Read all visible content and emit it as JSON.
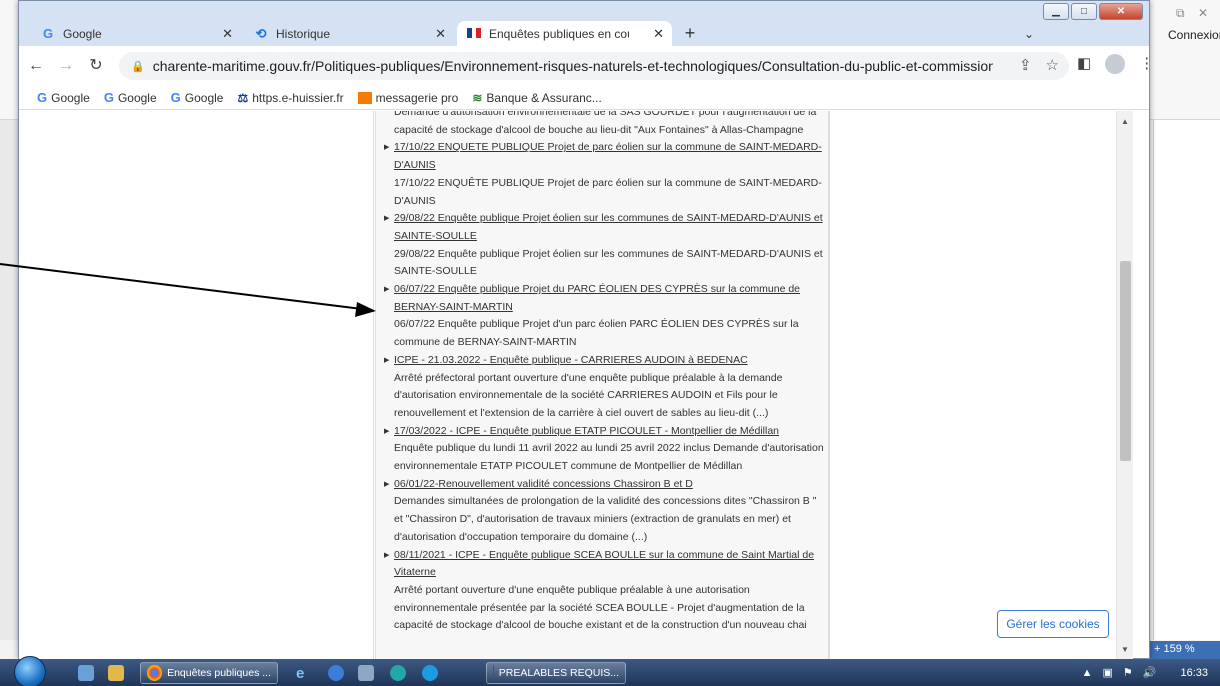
{
  "background_app": {
    "connexion_label": "Connexion",
    "zoom_label": "159 %",
    "window_controls": [
      "restore-icon",
      "close-icon"
    ]
  },
  "browser": {
    "tabs": [
      {
        "title": "Google",
        "icon": "google-icon",
        "active": false
      },
      {
        "title": "Historique",
        "icon": "history-icon",
        "active": false
      },
      {
        "title": "Enquêtes publiques en cours / C",
        "icon": "flag-icon",
        "active": true
      }
    ],
    "new_tab_label": "+",
    "tab_search_label": "⌄",
    "url": "charente-maritime.gouv.fr/Politiques-publiques/Environnement-risques-naturels-et-technologiques/Consultation-du-public-et-commissions-consultati...",
    "bookmarks": [
      {
        "label": "Google",
        "icon": "google-icon"
      },
      {
        "label": "Google",
        "icon": "google-icon"
      },
      {
        "label": "Google",
        "icon": "google-icon"
      },
      {
        "label": "https.e-huissier.fr",
        "icon": "huissier-icon"
      },
      {
        "label": "messagerie pro",
        "icon": "orange-icon"
      },
      {
        "label": "Banque & Assuranc...",
        "icon": "bank-icon"
      }
    ]
  },
  "page": {
    "entries": [
      {
        "link": "",
        "desc": "Demande d'autorisation environnementale de la SAS GOURDET pour l'augmentation de la capacité de stockage d'alcool de bouche au lieu-dit \"Aux Fontaines\" à Allas-Champagne"
      },
      {
        "link": "17/10/22 ENQUETE PUBLIQUE Projet de parc éolien sur la commune de SAINT-MEDARD-D'AUNIS",
        "desc": "17/10/22 ENQUÊTE PUBLIQUE Projet de parc éolien sur la commune de SAINT-MEDARD-D'AUNIS"
      },
      {
        "link": "29/08/22 Enquête publique Projet éolien sur les communes de SAINT-MEDARD-D'AUNIS et SAINTE-SOULLE",
        "desc": "29/08/22 Enquête publique Projet éolien sur les communes de SAINT-MEDARD-D'AUNIS et SAINTE-SOULLE"
      },
      {
        "link": "06/07/22 Enquête publique Projet du PARC ÉOLIEN DES CYPRÈS sur la commune de BERNAY-SAINT-MARTIN",
        "desc": "06/07/22 Enquête publique Projet d'un parc éolien PARC ÉOLIEN DES CYPRÈS sur la commune de BERNAY-SAINT-MARTIN"
      },
      {
        "link": "ICPE - 21.03.2022 - Enquête publique - CARRIERES AUDOIN à BEDENAC",
        "desc": "Arrêté préfectoral portant ouverture d'une enquête publique préalable à la demande d'autorisation environnementale de la société CARRIERES AUDOIN et Fils pour le renouvellement et l'extension de la carrière à ciel ouvert de sables au lieu-dit (...)"
      },
      {
        "link": "17/03/2022 - ICPE - Enquête publique ETATP PICOULET - Montpellier de Médillan",
        "desc": "Enquête publique du lundi 11 avril 2022 au lundi 25 avril 2022 inclus Demande d'autorisation environnementale ETATP PICOULET commune de Montpellier de Médillan"
      },
      {
        "link": "06/01/22-Renouvellement validité concessions Chassiron B et D",
        "desc": "Demandes simultanées de prolongation de la validité des concessions dites \"Chassiron B \" et \"Chassiron D\", d'autorisation de travaux miniers (extraction de granulats en mer) et d'autorisation d'occupation temporaire du domaine (...)"
      },
      {
        "link": "08/11/2021 - ICPE - Enquête publique SCEA BOULLE sur la commune de Saint Martial de Vitaterne",
        "desc": "Arrêté portant ouverture d'une enquête publique préalable à une autorisation environnementale présentée par la société SCEA BOULLE - Projet d'augmentation de la capacité de stockage d'alcool de bouche existant et de la construction d'un nouveau chai"
      }
    ],
    "cookies_button": "Gérer les cookies"
  },
  "taskbar": {
    "items": [
      {
        "label": "Enquêtes publiques ...",
        "icon": "chrome-icon"
      },
      {
        "label": "PREALABLES REQUIS...",
        "icon": "word-icon"
      }
    ],
    "clock": "16:33"
  },
  "colors": {
    "titlebar": "#d5e2f3",
    "taskbar": "#1f3557",
    "cookies_accent": "#2a6fd1"
  }
}
